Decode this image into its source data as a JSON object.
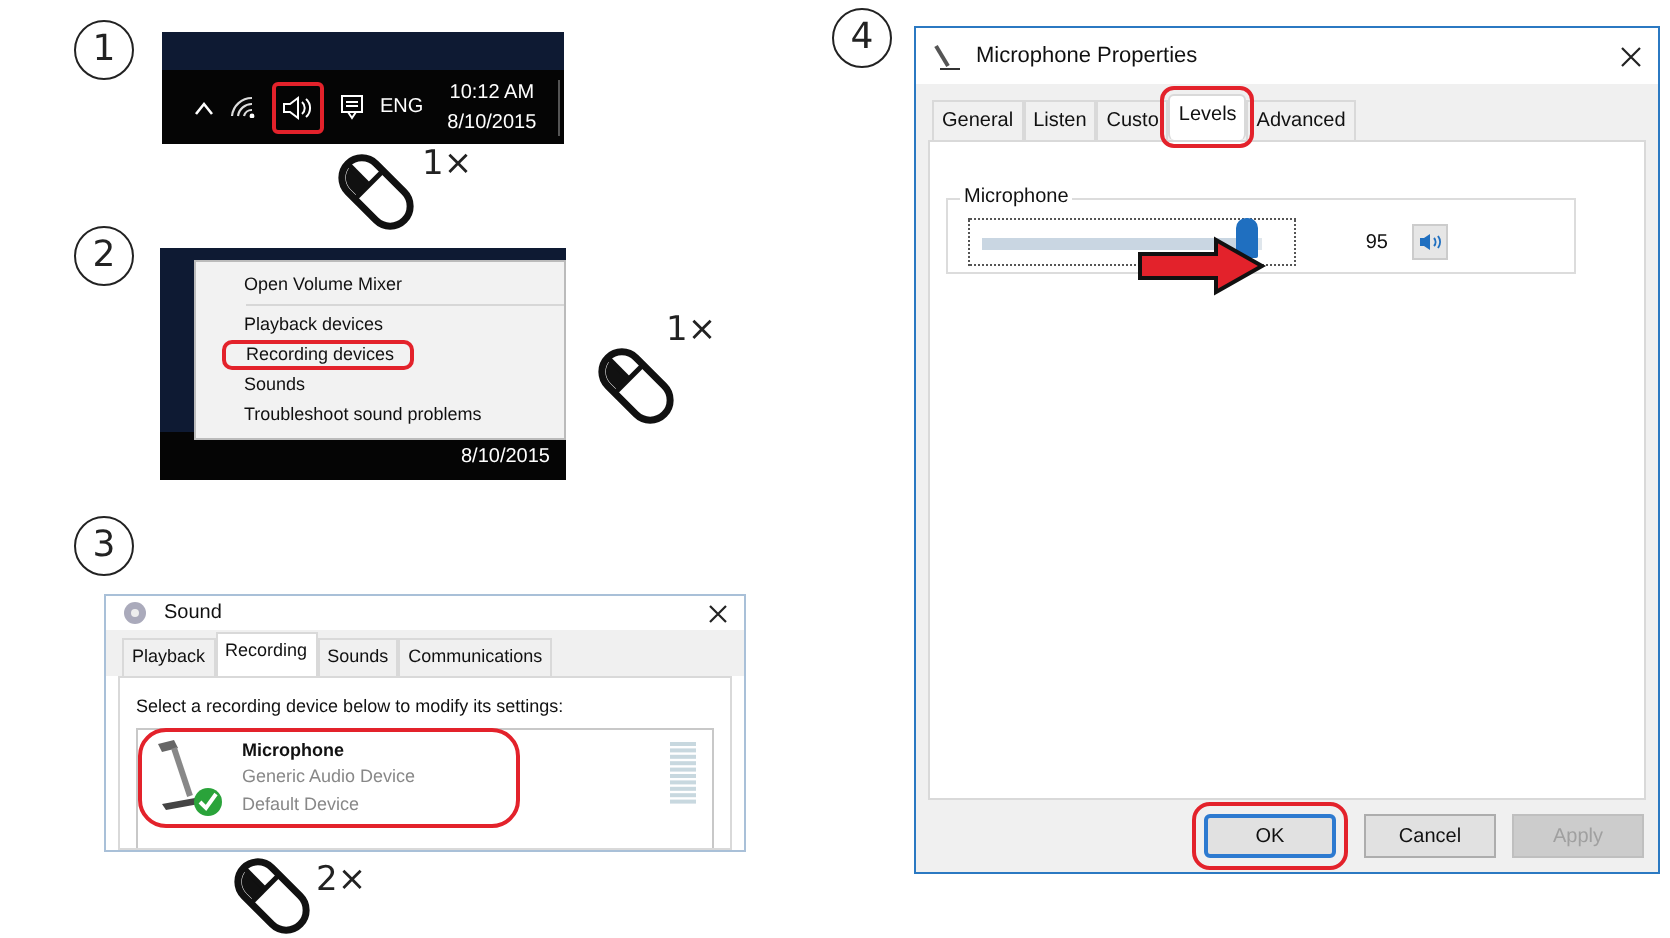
{
  "steps": [
    {
      "number": "1",
      "kind": "taskbar",
      "volume_highlighted": true,
      "language": "ENG",
      "time": "10:12 AM",
      "date": "8/10/2015",
      "clicks": "1×"
    },
    {
      "number": "2",
      "kind": "menu",
      "menu_groups": [
        {
          "items": [
            {
              "label": "Open Volume Mixer",
              "highlighted": false
            }
          ]
        },
        {
          "items": [
            {
              "label": "Playback devices",
              "highlighted": false
            },
            {
              "label": "Recording devices",
              "highlighted": true
            },
            {
              "label": "Sounds",
              "highlighted": false
            },
            {
              "label": "Troubleshoot sound problems",
              "highlighted": false
            }
          ]
        }
      ],
      "date": "8/10/2015",
      "clicks": "1×"
    },
    {
      "number": "3",
      "kind": "sound-window",
      "title": "Sound",
      "tabs": [
        {
          "label": "Playback",
          "selected": false
        },
        {
          "label": "Recording",
          "selected": true
        },
        {
          "label": "Sounds",
          "selected": false
        },
        {
          "label": "Communications",
          "selected": false
        }
      ],
      "instruction": "Select a recording device below to modify its settings:",
      "devices": [
        {
          "name": "Microphone",
          "description": "Generic Audio Device",
          "status": "Default Device",
          "default": true,
          "highlighted": true
        }
      ],
      "clicks": "2×"
    },
    {
      "number": "4",
      "kind": "properties-window",
      "title": "Microphone Properties",
      "tabs": [
        {
          "label": "General",
          "selected": false,
          "highlighted": false
        },
        {
          "label": "Listen",
          "selected": false,
          "highlighted": false
        },
        {
          "label": "Custo",
          "selected": false,
          "highlighted": false
        },
        {
          "label": "Levels",
          "selected": true,
          "highlighted": true
        },
        {
          "label": "Advanced",
          "selected": false,
          "highlighted": false
        }
      ],
      "group": "Microphone",
      "slider": {
        "level": 0.95,
        "reading": "95"
      },
      "buttons": [
        {
          "label": "OK",
          "default": true,
          "disabled": false,
          "highlighted": true
        },
        {
          "label": "Cancel",
          "default": false,
          "disabled": false,
          "highlighted": false
        },
        {
          "label": "Apply",
          "default": false,
          "disabled": true,
          "highlighted": false
        }
      ]
    }
  ]
}
